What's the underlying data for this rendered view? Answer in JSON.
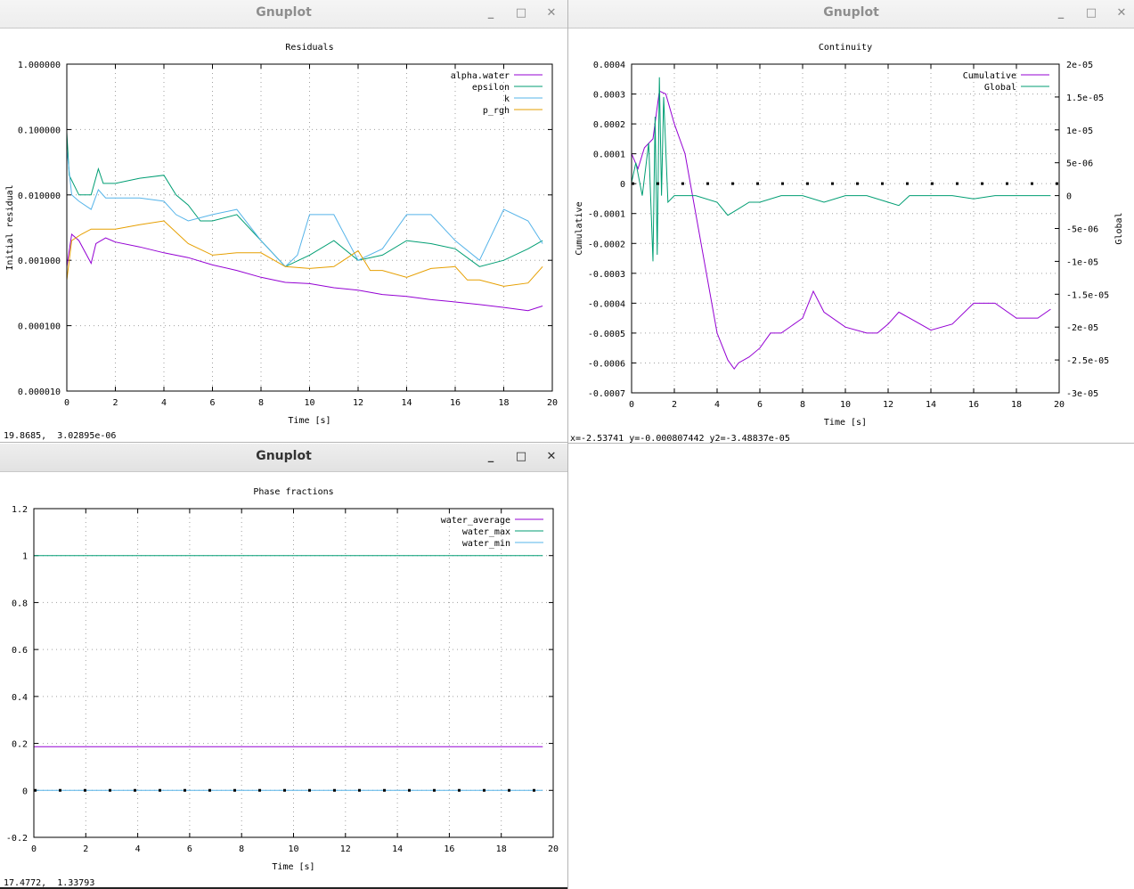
{
  "windows": {
    "residuals": {
      "title": "Gnuplot",
      "status": "19.8685,  3.02895e-06",
      "buttons": {
        "minimize": "_",
        "maximize": "□",
        "close": "✕"
      }
    },
    "continuity": {
      "title": "Gnuplot",
      "status": "x=-2.53741 y=-0.000807442 y2=-3.48837e-05",
      "buttons": {
        "minimize": "_",
        "maximize": "□",
        "close": "✕"
      }
    },
    "phase": {
      "title": "Gnuplot",
      "status": "17.4772,  1.33793",
      "buttons": {
        "minimize": "_",
        "maximize": "□",
        "close": "✕"
      }
    }
  },
  "colors": {
    "purple": "#9400d3",
    "green": "#009e73",
    "cyan": "#56b4e9",
    "orange": "#e69f00",
    "grid": "#a0a0a0",
    "titlebar_text": "#333333"
  },
  "chart_data": [
    {
      "id": "residuals",
      "type": "line",
      "title": "Residuals",
      "xlabel": "Time [s]",
      "ylabel": "Initial residual",
      "xlim": [
        0,
        20
      ],
      "ylim": [
        1e-05,
        1
      ],
      "log_y": true,
      "grid": true,
      "legend_position": "top-right",
      "x_ticks": [
        0,
        2,
        4,
        6,
        8,
        10,
        12,
        14,
        16,
        18,
        20
      ],
      "x_tick_labels": [
        "0",
        "2",
        "4",
        "6",
        "8",
        "10",
        "12",
        "14",
        "16",
        "18",
        "20"
      ],
      "y_ticks": [
        1e-05,
        0.0001,
        0.001,
        0.01,
        0.1,
        1
      ],
      "y_tick_labels": [
        "0.000010",
        "0.000100",
        "0.001000",
        "0.010000",
        "0.100000",
        "1.000000"
      ],
      "series": [
        {
          "name": "alpha.water",
          "color": "#9400d3",
          "x": [
            0,
            0.2,
            0.5,
            1.0,
            1.2,
            1.6,
            2,
            3,
            4,
            5,
            6,
            7,
            8,
            9,
            10,
            11,
            12,
            13,
            14,
            15,
            16,
            17,
            18,
            19,
            19.6
          ],
          "y": [
            0.0008,
            0.0025,
            0.002,
            0.0009,
            0.0018,
            0.0022,
            0.0019,
            0.0016,
            0.0013,
            0.0011,
            0.00085,
            0.0007,
            0.00055,
            0.00046,
            0.00044,
            0.00038,
            0.00035,
            0.0003,
            0.00028,
            0.00025,
            0.00023,
            0.00021,
            0.00019,
            0.00017,
            0.0002
          ]
        },
        {
          "name": "epsilon",
          "color": "#009e73",
          "x": [
            0,
            0.1,
            0.5,
            1.0,
            1.3,
            1.5,
            2,
            3,
            4,
            4.5,
            5,
            5.5,
            6,
            7,
            8,
            9,
            10,
            11,
            12,
            13,
            14,
            15,
            16,
            17,
            18,
            19,
            19.6
          ],
          "y": [
            0.09,
            0.02,
            0.01,
            0.01,
            0.025,
            0.015,
            0.015,
            0.018,
            0.02,
            0.01,
            0.007,
            0.004,
            0.004,
            0.005,
            0.002,
            0.0008,
            0.0012,
            0.002,
            0.001,
            0.0012,
            0.002,
            0.0018,
            0.0015,
            0.0008,
            0.001,
            0.0015,
            0.002
          ]
        },
        {
          "name": "k",
          "color": "#56b4e9",
          "x": [
            0,
            0.2,
            0.5,
            1.0,
            1.3,
            1.6,
            2,
            3,
            4,
            4.5,
            5,
            6,
            7,
            8,
            9,
            9.5,
            10,
            11,
            12,
            13,
            14,
            15,
            16,
            17,
            18,
            19,
            19.6
          ],
          "y": [
            0.05,
            0.01,
            0.008,
            0.006,
            0.012,
            0.009,
            0.009,
            0.009,
            0.008,
            0.005,
            0.004,
            0.005,
            0.006,
            0.002,
            0.0008,
            0.0012,
            0.005,
            0.005,
            0.001,
            0.0015,
            0.005,
            0.005,
            0.002,
            0.001,
            0.006,
            0.004,
            0.0018
          ]
        },
        {
          "name": "p_rgh",
          "color": "#e69f00",
          "x": [
            0,
            0.2,
            0.6,
            1.0,
            2,
            3,
            4,
            5,
            6,
            7,
            8,
            9,
            10,
            11,
            12,
            12.5,
            13,
            14,
            15,
            16,
            16.5,
            17,
            18,
            19,
            19.6
          ],
          "y": [
            0.0005,
            0.002,
            0.0025,
            0.003,
            0.003,
            0.0035,
            0.004,
            0.0018,
            0.0012,
            0.0013,
            0.0013,
            0.0008,
            0.00075,
            0.0008,
            0.0014,
            0.0007,
            0.0007,
            0.00055,
            0.00075,
            0.0008,
            0.0005,
            0.0005,
            0.0004,
            0.00045,
            0.0008
          ]
        }
      ]
    },
    {
      "id": "continuity",
      "type": "line",
      "title": "Continuity",
      "xlabel": "Time [s]",
      "ylabel": "Cumulative",
      "y2label": "Global",
      "xlim": [
        0,
        20
      ],
      "ylim": [
        -0.0007,
        0.0004
      ],
      "y2lim": [
        -3e-05,
        2e-05
      ],
      "grid": true,
      "legend_position": "top-right",
      "x_ticks": [
        0,
        2,
        4,
        6,
        8,
        10,
        12,
        14,
        16,
        18,
        20
      ],
      "x_tick_labels": [
        "0",
        "2",
        "4",
        "6",
        "8",
        "10",
        "12",
        "14",
        "16",
        "18",
        "20"
      ],
      "y_ticks": [
        0.0004,
        0.0003,
        0.0002,
        0.0001,
        0,
        -0.0001,
        -0.0002,
        -0.0003,
        -0.0004,
        -0.0005,
        -0.0006,
        -0.0007
      ],
      "y_tick_labels": [
        "0.0004",
        "0.0003",
        "0.0002",
        "0.0001",
        "0",
        "-0.0001",
        "-0.0002",
        "-0.0003",
        "-0.0004",
        "-0.0005",
        "-0.0006",
        "-0.0007"
      ],
      "y2_ticks": [
        2e-05,
        1.5e-05,
        1e-05,
        5e-06,
        0,
        -5e-06,
        -1e-05,
        -1.5e-05,
        -2e-05,
        -2.5e-05,
        -3e-05
      ],
      "y2_tick_labels": [
        "2e-05",
        "1.5e-05",
        "1e-05",
        "5e-06",
        "0",
        "-5e-06",
        "-1e-05",
        "-1.5e-05",
        "-2e-05",
        "-2.5e-05",
        "-3e-05"
      ],
      "series": [
        {
          "name": "Cumulative",
          "color": "#9400d3",
          "axis": "y",
          "x": [
            0,
            0.3,
            0.6,
            1.0,
            1.3,
            1.6,
            2,
            2.5,
            3,
            3.5,
            4,
            4.5,
            4.8,
            5.0,
            5.5,
            6,
            6.5,
            7,
            8,
            8.5,
            9,
            10,
            11,
            11.5,
            12,
            12.5,
            13,
            14,
            15,
            16,
            16.5,
            17,
            18,
            19,
            19.6
          ],
          "y": [
            0.0001,
            5e-05,
            0.00012,
            0.00015,
            0.00031,
            0.0003,
            0.0002,
            0.0001,
            -0.0001,
            -0.0003,
            -0.0005,
            -0.00059,
            -0.00062,
            -0.0006,
            -0.00058,
            -0.00055,
            -0.0005,
            -0.0005,
            -0.00045,
            -0.00036,
            -0.00043,
            -0.00048,
            -0.0005,
            -0.0005,
            -0.00047,
            -0.00043,
            -0.00045,
            -0.00049,
            -0.00047,
            -0.0004,
            -0.0004,
            -0.0004,
            -0.00045,
            -0.00045,
            -0.00042
          ]
        },
        {
          "name": "Global",
          "color": "#009e73",
          "axis": "y2",
          "x": [
            0,
            0.2,
            0.5,
            0.8,
            1.0,
            1.1,
            1.2,
            1.3,
            1.4,
            1.5,
            1.7,
            2.0,
            3,
            4,
            4.5,
            5,
            5.5,
            6,
            7,
            8,
            9,
            10,
            11,
            12,
            12.5,
            13,
            14,
            15,
            16,
            17,
            18,
            19,
            19.6
          ],
          "y": [
            2e-06,
            5e-06,
            0,
            8e-06,
            -1e-05,
            1.2e-05,
            -9e-06,
            1.8e-05,
            0,
            1.5e-05,
            -1e-06,
            0,
            0,
            -1e-06,
            -3e-06,
            -2e-06,
            -1e-06,
            -1e-06,
            0,
            0,
            -1e-06,
            0,
            0,
            -1e-06,
            -1.5e-06,
            0,
            0,
            0,
            -5e-07,
            0,
            0,
            0,
            0
          ]
        }
      ]
    },
    {
      "id": "phase",
      "type": "line",
      "title": "Phase fractions",
      "xlabel": "Time [s]",
      "ylabel": "",
      "xlim": [
        0,
        20
      ],
      "ylim": [
        -0.2,
        1.2
      ],
      "grid": true,
      "legend_position": "top-right",
      "x_ticks": [
        0,
        2,
        4,
        6,
        8,
        10,
        12,
        14,
        16,
        18,
        20
      ],
      "x_tick_labels": [
        "0",
        "2",
        "4",
        "6",
        "8",
        "10",
        "12",
        "14",
        "16",
        "18",
        "20"
      ],
      "y_ticks": [
        1.2,
        1,
        0.8,
        0.6,
        0.4,
        0.2,
        0,
        -0.2
      ],
      "y_tick_labels": [
        "1.2",
        "1",
        "0.8",
        "0.6",
        "0.4",
        "0.2",
        "0",
        "-0.2"
      ],
      "series": [
        {
          "name": "water_average",
          "color": "#9400d3",
          "x": [
            0,
            19.6
          ],
          "y": [
            0.186,
            0.186
          ]
        },
        {
          "name": "water_max",
          "color": "#009e73",
          "x": [
            0,
            19.6
          ],
          "y": [
            1,
            1
          ]
        },
        {
          "name": "water_min",
          "color": "#56b4e9",
          "x": [
            0,
            19.6
          ],
          "y": [
            0,
            0
          ]
        }
      ]
    }
  ]
}
